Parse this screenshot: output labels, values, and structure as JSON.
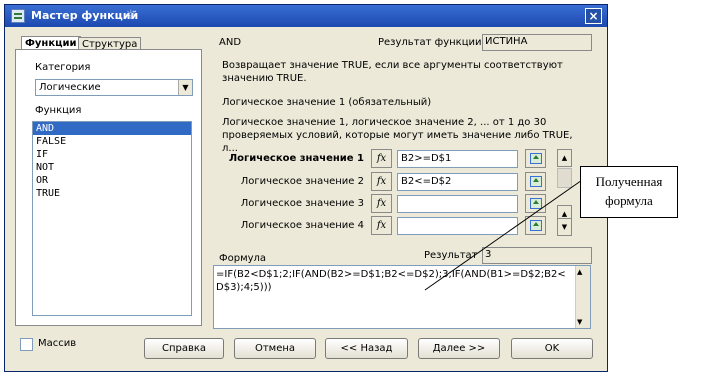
{
  "window": {
    "title": "Мастер функций",
    "close_glyph": "×"
  },
  "tabs": [
    {
      "label": "Функции",
      "active": true
    },
    {
      "label": "Структура",
      "active": false
    }
  ],
  "left": {
    "category_label": "Категория",
    "category_value": "Логические",
    "function_label": "Функция",
    "functions": [
      {
        "name": "AND",
        "selected": true
      },
      {
        "name": "FALSE",
        "selected": false
      },
      {
        "name": "IF",
        "selected": false
      },
      {
        "name": "NOT",
        "selected": false
      },
      {
        "name": "OR",
        "selected": false
      },
      {
        "name": "TRUE",
        "selected": false
      }
    ],
    "array_label": "Массив"
  },
  "right": {
    "function_name": "AND",
    "result_label": "Результат функции",
    "result_value": "ИСТИНА",
    "description": "Возвращает значение TRUE, если все аргументы соответствуют значению TRUE.",
    "arg_heading": "Логическое значение 1 (обязательный)",
    "arg_description": "Логическое значение 1, логическое значение 2, ... от 1 до 30 проверяемых условий, которые могут иметь значение либо TRUE, л...",
    "fx_label": "fx",
    "args": [
      {
        "label": "Логическое значение 1",
        "value": "B2>=D$1",
        "required": true
      },
      {
        "label": "Логическое значение 2",
        "value": "B2<=D$2",
        "required": false
      },
      {
        "label": "Логическое значение 3",
        "value": "",
        "required": false
      },
      {
        "label": "Логическое значение 4",
        "value": "",
        "required": false
      }
    ],
    "formula_label": "Формула",
    "result2_label": "Результат",
    "result2_value": "3",
    "formula_text": "=IF(B2<D$1;2;IF(AND(B2>=D$1;B2<=D$2);3;IF(AND(B1>=D$2;B2<D$3);4;5)))"
  },
  "buttons": {
    "help": "Справка",
    "cancel": "Отмена",
    "back": "<< Назад",
    "next": "Далее >>",
    "ok": "OK"
  },
  "annotation": {
    "line1": "Полученная",
    "line2": "формула"
  },
  "colors": {
    "titlebar": "#1c48b0",
    "selection": "#316ac5",
    "dialog_bg": "#ece9d8"
  }
}
